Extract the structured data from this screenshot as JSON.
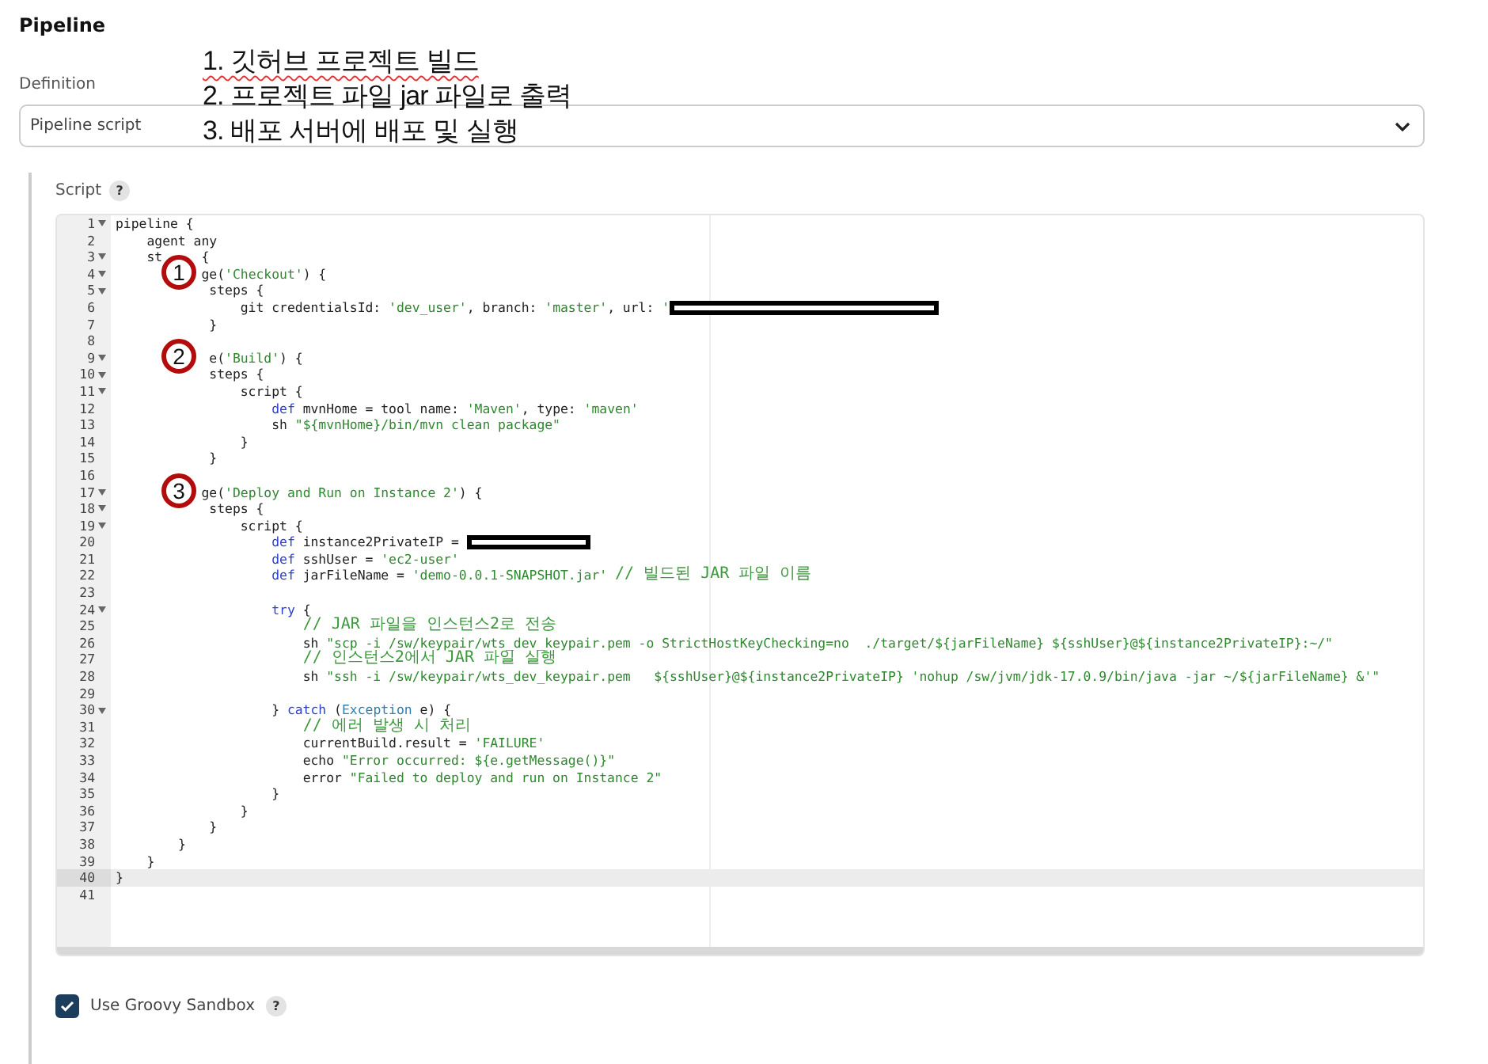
{
  "section_title": "Pipeline",
  "annotation_list": [
    "1. 깃허브 프로젝트 빌드",
    "2. 프로젝트 파일 jar 파일로 출력",
    "3. 배포 서버에 배포 및 실행"
  ],
  "definition": {
    "label": "Definition",
    "value": "Pipeline script"
  },
  "script": {
    "label": "Script",
    "help": "?"
  },
  "markers": [
    "1",
    "2",
    "3"
  ],
  "lines": [
    {
      "num": "1",
      "fold": true,
      "current": false,
      "seg": [
        {
          "kind": "plain",
          "text": "pipeline {"
        }
      ]
    },
    {
      "num": "2",
      "fold": false,
      "current": false,
      "seg": [
        {
          "kind": "plain",
          "text": "    agent any"
        }
      ]
    },
    {
      "num": "3",
      "fold": true,
      "current": false,
      "seg": [
        {
          "kind": "plain",
          "text": "    st"
        },
        {
          "kind": "plain",
          "text": "     {"
        }
      ]
    },
    {
      "num": "4",
      "fold": true,
      "current": false,
      "seg": [
        {
          "kind": "plain",
          "text": "           ge("
        },
        {
          "kind": "string",
          "text": "'Checkout'"
        },
        {
          "kind": "plain",
          "text": ") {"
        }
      ]
    },
    {
      "num": "5",
      "fold": true,
      "current": false,
      "seg": [
        {
          "kind": "plain",
          "text": "            steps {"
        }
      ]
    },
    {
      "num": "6",
      "fold": false,
      "current": false,
      "seg": [
        {
          "kind": "plain",
          "text": "                git credentialsId: "
        },
        {
          "kind": "string",
          "text": "'dev_user'"
        },
        {
          "kind": "plain",
          "text": ", branch: "
        },
        {
          "kind": "string",
          "text": "'master'"
        },
        {
          "kind": "plain",
          "text": ", url: "
        },
        {
          "kind": "string",
          "text": "'"
        },
        {
          "kind": "redacted"
        }
      ]
    },
    {
      "num": "7",
      "fold": false,
      "current": false,
      "seg": [
        {
          "kind": "plain",
          "text": "            }"
        }
      ]
    },
    {
      "num": "8",
      "fold": false,
      "current": false
    },
    {
      "num": "9",
      "fold": true,
      "current": false,
      "seg": [
        {
          "kind": "plain",
          "text": "            e("
        },
        {
          "kind": "string",
          "text": "'Build'"
        },
        {
          "kind": "plain",
          "text": ") {"
        }
      ]
    },
    {
      "num": "10",
      "fold": true,
      "current": false,
      "seg": [
        {
          "kind": "plain",
          "text": "            steps {"
        }
      ]
    },
    {
      "num": "11",
      "fold": true,
      "current": false,
      "seg": [
        {
          "kind": "plain",
          "text": "                script {"
        }
      ]
    },
    {
      "num": "12",
      "fold": false,
      "current": false,
      "seg": [
        {
          "kind": "keyword",
          "text": "                    def"
        },
        {
          "kind": "plain",
          "text": " mvnHome = tool name: "
        },
        {
          "kind": "string",
          "text": "'Maven'"
        },
        {
          "kind": "plain",
          "text": ", type: "
        },
        {
          "kind": "string",
          "text": "'maven'"
        }
      ]
    },
    {
      "num": "13",
      "fold": false,
      "current": false,
      "seg": [
        {
          "kind": "plain",
          "text": "                    sh "
        },
        {
          "kind": "string",
          "text": "\"${mvnHome}/bin/mvn clean package\""
        }
      ]
    },
    {
      "num": "14",
      "fold": false,
      "current": false,
      "seg": [
        {
          "kind": "plain",
          "text": "                }"
        }
      ]
    },
    {
      "num": "15",
      "fold": false,
      "current": false,
      "seg": [
        {
          "kind": "plain",
          "text": "            }"
        }
      ]
    },
    {
      "num": "16",
      "fold": false,
      "current": false
    },
    {
      "num": "17",
      "fold": true,
      "current": false,
      "seg": [
        {
          "kind": "plain",
          "text": "           ge("
        },
        {
          "kind": "string",
          "text": "'Deploy and Run on Instance 2'"
        },
        {
          "kind": "plain",
          "text": ") {"
        }
      ]
    },
    {
      "num": "18",
      "fold": true,
      "current": false,
      "seg": [
        {
          "kind": "plain",
          "text": "            steps {"
        }
      ]
    },
    {
      "num": "19",
      "fold": true,
      "current": false,
      "seg": [
        {
          "kind": "plain",
          "text": "                script {"
        }
      ]
    },
    {
      "num": "20",
      "fold": false,
      "current": false,
      "seg": [
        {
          "kind": "keyword",
          "text": "                    def"
        },
        {
          "kind": "plain",
          "text": " instance2PrivateIP = "
        },
        {
          "kind": "redacted"
        }
      ]
    },
    {
      "num": "21",
      "fold": false,
      "current": false,
      "seg": [
        {
          "kind": "keyword",
          "text": "                    def"
        },
        {
          "kind": "plain",
          "text": " sshUser = "
        },
        {
          "kind": "string",
          "text": "'ec2-user'"
        }
      ]
    },
    {
      "num": "22",
      "fold": false,
      "current": false,
      "seg": [
        {
          "kind": "keyword",
          "text": "                    def"
        },
        {
          "kind": "plain",
          "text": " jarFileName = "
        },
        {
          "kind": "string",
          "text": "'demo-0.0.1-SNAPSHOT.jar'"
        },
        {
          "kind": "comment",
          "text": " // 빌드된 JAR 파일 이름"
        }
      ]
    },
    {
      "num": "23",
      "fold": false,
      "current": false
    },
    {
      "num": "24",
      "fold": true,
      "current": false,
      "seg": [
        {
          "kind": "keyword",
          "text": "                    try"
        },
        {
          "kind": "plain",
          "text": " {"
        }
      ]
    },
    {
      "num": "25",
      "fold": false,
      "current": false,
      "seg": [
        {
          "kind": "comment",
          "text": "                        // JAR 파일을 인스턴스2로 전송"
        }
      ]
    },
    {
      "num": "26",
      "fold": false,
      "current": false,
      "seg": [
        {
          "kind": "plain",
          "text": "                        sh "
        },
        {
          "kind": "string",
          "text": "\"scp -i /sw/keypair/wts_dev_keypair.pem -o StrictHostKeyChecking=no  ./target/${jarFileName} ${sshUser}@${instance2PrivateIP}:~/\""
        }
      ]
    },
    {
      "num": "27",
      "fold": false,
      "current": false,
      "seg": [
        {
          "kind": "comment",
          "text": "                        // 인스턴스2에서 JAR 파일 실행"
        }
      ]
    },
    {
      "num": "28",
      "fold": false,
      "current": false,
      "seg": [
        {
          "kind": "plain",
          "text": "                        sh "
        },
        {
          "kind": "string",
          "text": "\"ssh -i /sw/keypair/wts_dev_keypair.pem   ${sshUser}@${instance2PrivateIP} 'nohup /sw/jvm/jdk-17.0.9/bin/java -jar ~/${jarFileName} &'\""
        }
      ]
    },
    {
      "num": "29",
      "fold": false,
      "current": false
    },
    {
      "num": "30",
      "fold": true,
      "current": false,
      "seg": [
        {
          "kind": "plain",
          "text": "                    } "
        },
        {
          "kind": "keyword",
          "text": "catch"
        },
        {
          "kind": "plain",
          "text": " ("
        },
        {
          "kind": "type",
          "text": "Exception"
        },
        {
          "kind": "plain",
          "text": " e) {"
        }
      ]
    },
    {
      "num": "31",
      "fold": false,
      "current": false,
      "seg": [
        {
          "kind": "comment",
          "text": "                        // 에러 발생 시 처리"
        }
      ]
    },
    {
      "num": "32",
      "fold": false,
      "current": false,
      "seg": [
        {
          "kind": "plain",
          "text": "                        currentBuild.result = "
        },
        {
          "kind": "string",
          "text": "'FAILURE'"
        }
      ]
    },
    {
      "num": "33",
      "fold": false,
      "current": false,
      "seg": [
        {
          "kind": "plain",
          "text": "                        echo "
        },
        {
          "kind": "string",
          "text": "\"Error occurred: ${e.getMessage()}\""
        }
      ]
    },
    {
      "num": "34",
      "fold": false,
      "current": false,
      "seg": [
        {
          "kind": "plain",
          "text": "                        error "
        },
        {
          "kind": "string",
          "text": "\"Failed to deploy and run on Instance 2\""
        }
      ]
    },
    {
      "num": "35",
      "fold": false,
      "current": false,
      "seg": [
        {
          "kind": "plain",
          "text": "                    }"
        }
      ]
    },
    {
      "num": "36",
      "fold": false,
      "current": false,
      "seg": [
        {
          "kind": "plain",
          "text": "                }"
        }
      ]
    },
    {
      "num": "37",
      "fold": false,
      "current": false,
      "seg": [
        {
          "kind": "plain",
          "text": "            }"
        }
      ]
    },
    {
      "num": "38",
      "fold": false,
      "current": false,
      "seg": [
        {
          "kind": "plain",
          "text": "        }"
        }
      ]
    },
    {
      "num": "39",
      "fold": false,
      "current": false,
      "seg": [
        {
          "kind": "plain",
          "text": "    }"
        }
      ]
    },
    {
      "num": "40",
      "fold": false,
      "current": true,
      "seg": [
        {
          "kind": "plain",
          "text": "}"
        }
      ]
    },
    {
      "num": "41",
      "fold": false,
      "current": false
    }
  ],
  "sandbox": {
    "label": "Use Groovy Sandbox",
    "checked": true,
    "help": "?"
  }
}
